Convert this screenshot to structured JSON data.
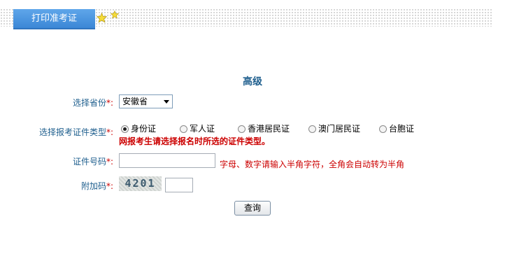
{
  "header": {
    "tab_label": "打印准考证"
  },
  "page_title": "高级",
  "form": {
    "province": {
      "label": "选择省份",
      "required_mark": "*:",
      "selected": "安徽省"
    },
    "id_type": {
      "label": "选择报考证件类型",
      "required_mark": "*:",
      "options": [
        "身份证",
        "军人证",
        "香港居民证",
        "澳门居民证",
        "台胞证"
      ],
      "selected": "身份证",
      "warning": "网报考生请选择报名时所选的证件类型。"
    },
    "id_number": {
      "label": "证件号码",
      "required_mark": "*:",
      "value": "",
      "hint": "字母、数字请输入半角字符，全角会自动转为半角"
    },
    "captcha": {
      "label": "附加码",
      "required_mark": "*:",
      "code": "4201",
      "value": ""
    },
    "submit_label": "查询"
  },
  "icons": {
    "star": "star-icon"
  }
}
